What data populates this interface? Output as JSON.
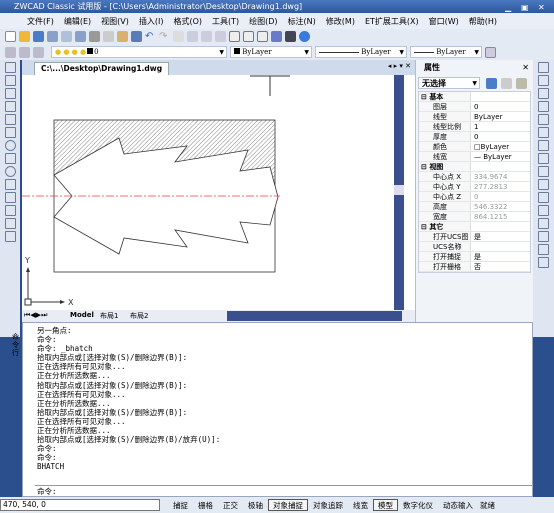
{
  "title": "ZWCAD Classic 试用版 - [C:\\Users\\Administrator\\Desktop\\Drawing1.dwg]",
  "menu": [
    "文件(F)",
    "编辑(E)",
    "视图(V)",
    "插入(I)",
    "格式(O)",
    "工具(T)",
    "绘图(D)",
    "标注(N)",
    "修改(M)",
    "ET扩展工具(X)",
    "窗口(W)",
    "帮助(H)"
  ],
  "layer": {
    "current": "0",
    "color": "ByLayer",
    "linetype": "ByLayer",
    "lineweight": "ByLayer"
  },
  "doc_tab": "C:\\...\\Desktop\\Drawing1.dwg",
  "layout_tabs": [
    "Model",
    "布局1",
    "布局2"
  ],
  "axis": {
    "x": "X",
    "y": "Y"
  },
  "colors": {
    "centerline": "#ff3b3b",
    "accent": "#2b4f8c"
  },
  "properties": {
    "title": "属性",
    "selection": "无选择",
    "sections": [
      {
        "name": "基本",
        "rows": [
          [
            "图层",
            "0"
          ],
          [
            "线型",
            "ByLayer"
          ],
          [
            "线型比例",
            "1"
          ],
          [
            "厚度",
            "0"
          ],
          [
            "颜色",
            "□ByLayer"
          ],
          [
            "线宽",
            "— ByLayer"
          ]
        ]
      },
      {
        "name": "视图",
        "rows": [
          [
            "中心点 X",
            "334.9674"
          ],
          [
            "中心点 Y",
            "277.2813"
          ],
          [
            "中心点 Z",
            "0"
          ],
          [
            "高度",
            "546.3322"
          ],
          [
            "宽度",
            "864.1215"
          ]
        ]
      },
      {
        "name": "其它",
        "rows": [
          [
            "打开UCS图标",
            "是"
          ],
          [
            "UCS名称",
            ""
          ],
          [
            "打开捕捉",
            "是"
          ],
          [
            "打开栅格",
            "否"
          ]
        ]
      }
    ]
  },
  "command": {
    "side_label": "命令行",
    "log": [
      "另一角点:",
      "命令:",
      "命令: _bhatch",
      "拾取内部点或[选择对象(S)/删除边界(B)]:",
      "正在选择所有可见对象...",
      "正在分析所选数据...",
      "拾取内部点或[选择对象(S)/删除边界(B)]:",
      "正在选择所有可见对象...",
      "正在分析所选数据...",
      "拾取内部点或[选择对象(S)/删除边界(B)]:",
      "正在选择所有可见对象...",
      "正在分析所选数据...",
      "拾取内部点或[选择对象(S)/删除边界(B)/放弃(U)]:",
      "命令:",
      "命令:",
      "BHATCH"
    ],
    "prompt": "命令:"
  },
  "status": {
    "coords": "470, 540, 0",
    "buttons": [
      {
        "label": "捕捉",
        "on": false
      },
      {
        "label": "栅格",
        "on": false
      },
      {
        "label": "正交",
        "on": false
      },
      {
        "label": "极轴",
        "on": false
      },
      {
        "label": "对象捕捉",
        "on": true
      },
      {
        "label": "对象追踪",
        "on": false
      },
      {
        "label": "线宽",
        "on": false
      },
      {
        "label": "模型",
        "on": true
      },
      {
        "label": "数字化仪",
        "on": false
      },
      {
        "label": "动态输入",
        "on": false
      }
    ],
    "state": "就绪"
  }
}
